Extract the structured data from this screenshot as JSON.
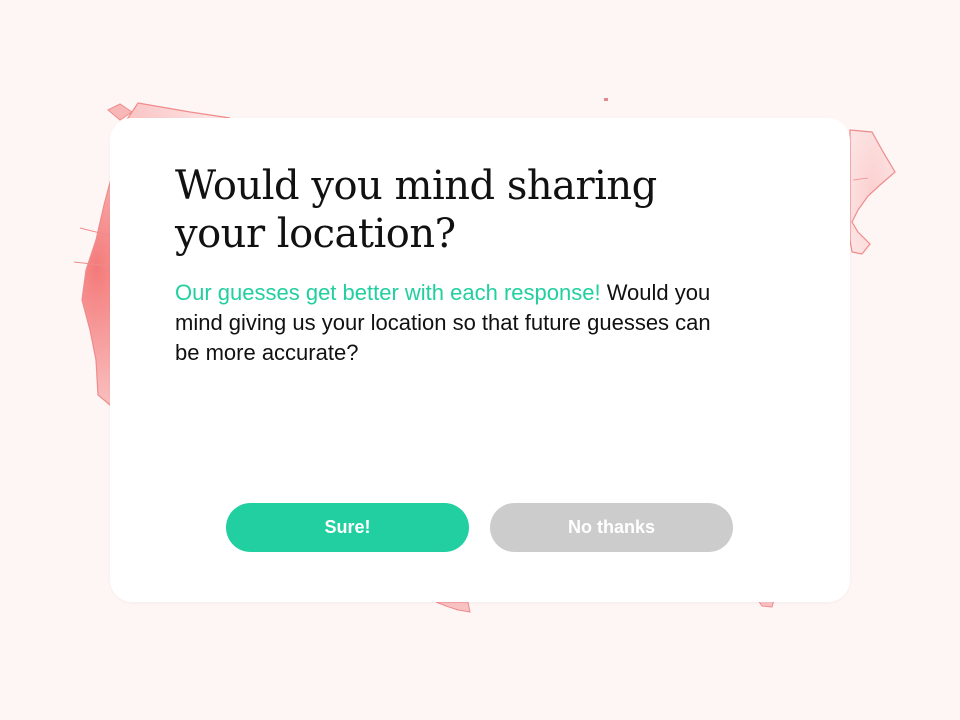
{
  "dialog": {
    "title": "Would you mind sharing your location?",
    "message_highlight": "Our guesses get better with each response!",
    "message_rest": " Would you mind giving us your location so that future guesses can be more accurate?",
    "accept_label": "Sure!",
    "decline_label": "No thanks"
  },
  "colors": {
    "accent": "#21cfa0",
    "decline": "#cccccc",
    "background": "#fdf6f5",
    "map_fill": "#f8b7b7",
    "map_stroke": "#f08b8b"
  },
  "background": {
    "map_icon": "us-map-heatmap"
  }
}
